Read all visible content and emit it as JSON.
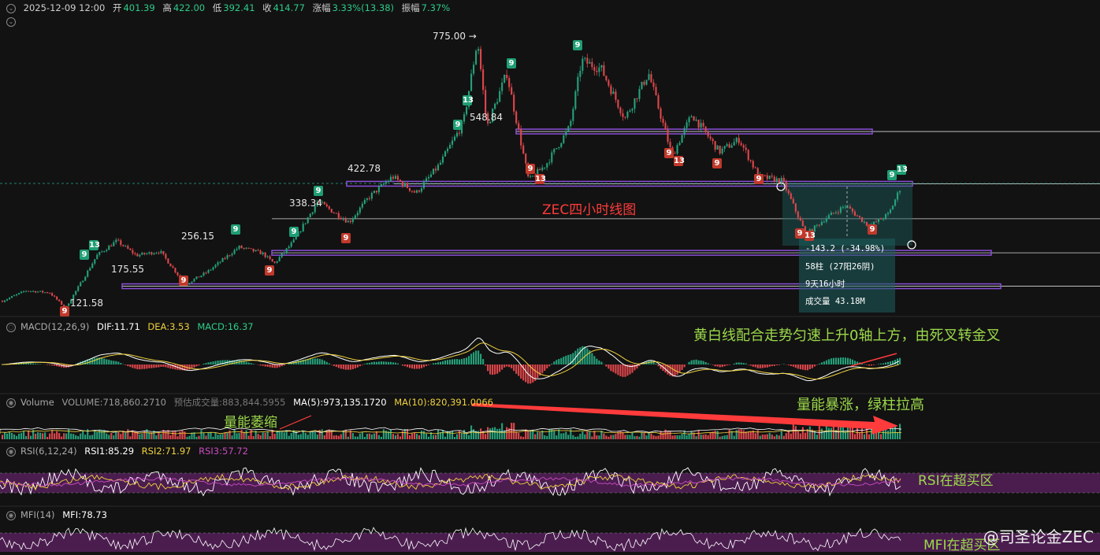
{
  "header": {
    "datetime": "2025-12-09 12:00",
    "open_label": "开",
    "open": "401.39",
    "high_label": "高",
    "high": "422.00",
    "low_label": "低",
    "low": "392.41",
    "close_label": "收",
    "close": "414.77",
    "change_label": "涨幅",
    "change": "3.33%(13.38)",
    "amp_label": "振幅",
    "amp": "7.37%"
  },
  "price_labels": {
    "p775": "775.00 →",
    "p548": "548.84",
    "p422": "422.78",
    "p338": "338.34",
    "p256": "256.15",
    "p175": "175.55",
    "p121": "121.58"
  },
  "annotations": {
    "chart_title": "ZEC四小时线图",
    "macd_note": "黄白线配合走势匀速上升0轴上方，由死叉转金叉",
    "volume_note": "量能暴涨，绿柱拉高",
    "volume_shrink": "量能萎缩",
    "rsi_note": "RSI在超买区",
    "mfi_note": "MFI在超买区"
  },
  "measure_box": {
    "line1": "-143.2 (-34.98%)",
    "line2": "58柱 (27阳26阴)",
    "line3": "9天16小时",
    "line4": "成交量 43.18M"
  },
  "indicators": {
    "macd": {
      "name": "MACD(12,26,9)",
      "dif": "DIF:11.71",
      "dea": "DEA:3.53",
      "macd": "MACD:16.37"
    },
    "volume": {
      "name": "Volume",
      "vol": "VOLUME:718,860.2710",
      "est": "预估成交量:883,844.5955",
      "ma5": "MA(5):973,135.1720",
      "ma10": "MA(10):820,391.0066"
    },
    "rsi": {
      "name": "RSI(6,12,24)",
      "rsi1": "RSI1:85.29",
      "rsi2": "RSI2:71.97",
      "rsi3": "RSI3:57.72"
    },
    "mfi": {
      "name": "MFI(14)",
      "mfi": "MFI:78.73"
    }
  },
  "watermark": "@司圣论金ZEC",
  "colors": {
    "up": "#26a17b",
    "down": "#e0474c",
    "dif": "#ffffff",
    "dea": "#f0d23c",
    "zone": "#8a4fd8",
    "rsi_band": "#4b1d4f",
    "arrow": "#ff3b3b",
    "note_green": "#9bd84a"
  },
  "chart_data": {
    "type": "candlestick",
    "price_range": [
      100,
      800
    ],
    "key_levels": [
      548.84,
      422.78,
      338.34,
      256.15,
      175.55
    ],
    "high": 775.0,
    "low": 121.58,
    "path": [
      {
        "t": 0,
        "p": 140
      },
      {
        "t": 30,
        "p": 165
      },
      {
        "t": 60,
        "p": 160
      },
      {
        "t": 80,
        "p": 123
      },
      {
        "t": 100,
        "p": 185
      },
      {
        "t": 120,
        "p": 250
      },
      {
        "t": 145,
        "p": 285
      },
      {
        "t": 170,
        "p": 250
      },
      {
        "t": 200,
        "p": 260
      },
      {
        "t": 232,
        "p": 180
      },
      {
        "t": 260,
        "p": 210
      },
      {
        "t": 300,
        "p": 270
      },
      {
        "t": 330,
        "p": 255
      },
      {
        "t": 345,
        "p": 230
      },
      {
        "t": 370,
        "p": 285
      },
      {
        "t": 400,
        "p": 380
      },
      {
        "t": 440,
        "p": 330
      },
      {
        "t": 465,
        "p": 390
      },
      {
        "t": 495,
        "p": 440
      },
      {
        "t": 525,
        "p": 400
      },
      {
        "t": 555,
        "p": 470
      },
      {
        "t": 585,
        "p": 570
      },
      {
        "t": 603,
        "p": 770
      },
      {
        "t": 615,
        "p": 560
      },
      {
        "t": 640,
        "p": 690
      },
      {
        "t": 668,
        "p": 430
      },
      {
        "t": 690,
        "p": 470
      },
      {
        "t": 720,
        "p": 560
      },
      {
        "t": 735,
        "p": 720
      },
      {
        "t": 760,
        "p": 700
      },
      {
        "t": 790,
        "p": 580
      },
      {
        "t": 820,
        "p": 690
      },
      {
        "t": 850,
        "p": 490
      },
      {
        "t": 875,
        "p": 590
      },
      {
        "t": 910,
        "p": 500
      },
      {
        "t": 935,
        "p": 530
      },
      {
        "t": 960,
        "p": 440
      },
      {
        "t": 990,
        "p": 430
      },
      {
        "t": 1020,
        "p": 300
      },
      {
        "t": 1045,
        "p": 340
      },
      {
        "t": 1070,
        "p": 370
      },
      {
        "t": 1100,
        "p": 320
      },
      {
        "t": 1125,
        "p": 350
      },
      {
        "t": 1140,
        "p": 415
      }
    ]
  }
}
